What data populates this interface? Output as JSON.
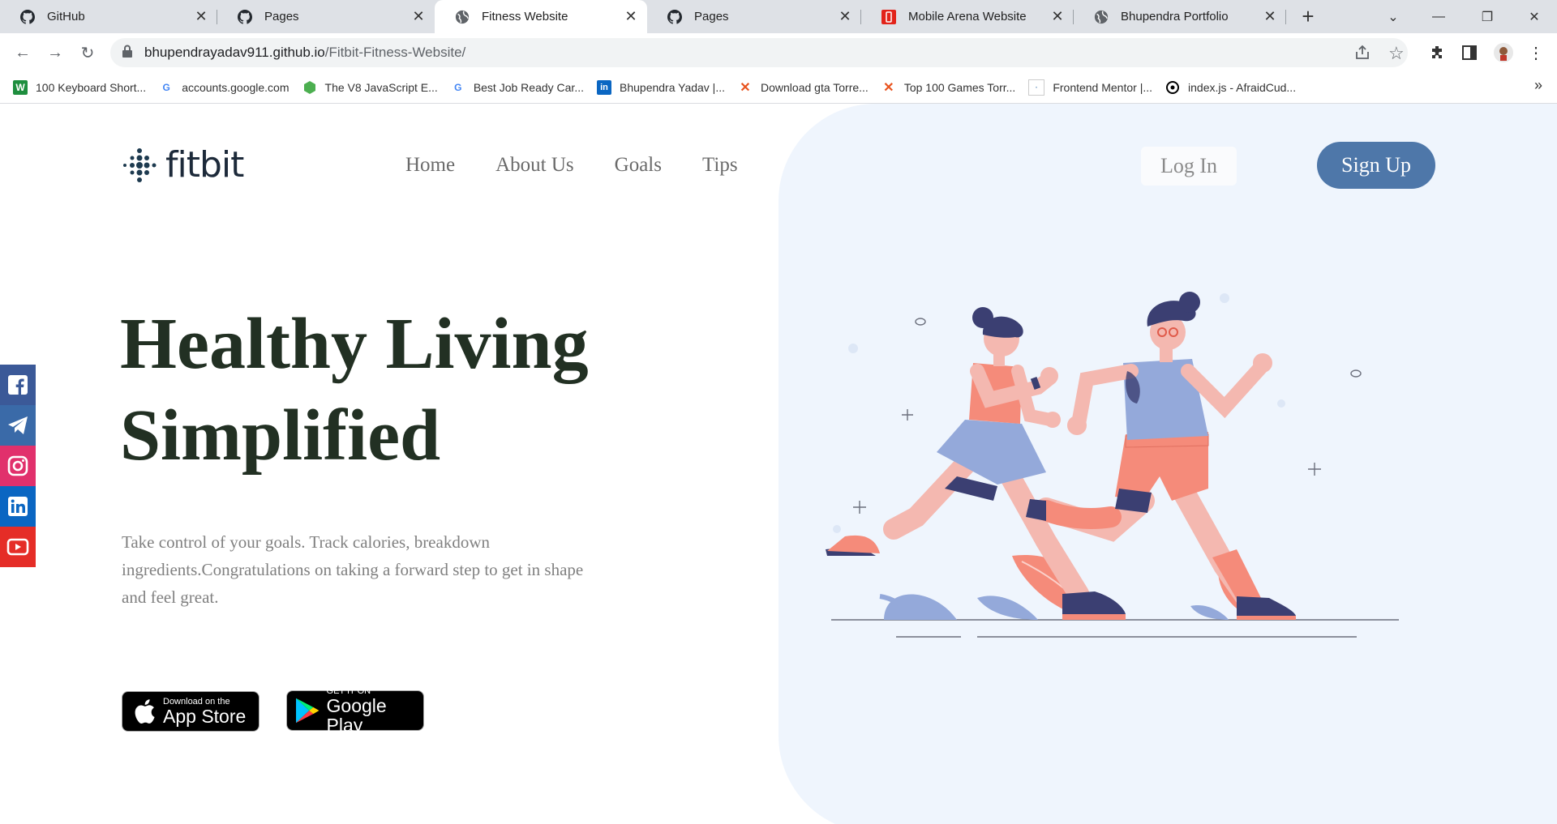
{
  "browser": {
    "tabs": [
      {
        "title": "GitHub",
        "icon": "github-icon",
        "active": false
      },
      {
        "title": "Pages",
        "icon": "github-icon",
        "active": false
      },
      {
        "title": "Fitness Website",
        "icon": "globe-icon",
        "active": true
      },
      {
        "title": "Pages",
        "icon": "github-icon",
        "active": false
      },
      {
        "title": "Mobile Arena Website",
        "icon": "mobile-arena-icon",
        "active": false
      },
      {
        "title": "Bhupendra Portfolio",
        "icon": "globe-icon",
        "active": false
      }
    ],
    "url_host": "bhupendrayadav911.github.io",
    "url_path": "/Fitbit-Fitness-Website/",
    "bookmarks": [
      {
        "label": "100 Keyboard Short...",
        "icon": "spreadsheet-icon",
        "color": "#1e8e3e"
      },
      {
        "label": "accounts.google.com",
        "icon": "google-icon",
        "color": "#4285f4"
      },
      {
        "label": "The V8 JavaScript E...",
        "icon": "v8-icon",
        "color": "#4caf50"
      },
      {
        "label": "Best Job Ready Car...",
        "icon": "google-icon",
        "color": "#4285f4"
      },
      {
        "label": "Bhupendra Yadav |...",
        "icon": "linkedin-icon",
        "color": "#0a66c2"
      },
      {
        "label": "Download gta Torre...",
        "icon": "x-icon",
        "color": "#e8531e"
      },
      {
        "label": "Top 100 Games Torr...",
        "icon": "x-icon",
        "color": "#e8531e"
      },
      {
        "label": "Frontend Mentor |...",
        "icon": "frontend-mentor-icon",
        "color": "#7aa0c8"
      },
      {
        "label": "index.js - AfraidCud...",
        "icon": "replit-icon",
        "color": "#000000"
      }
    ]
  },
  "site": {
    "logo_text": "fitbit",
    "nav": [
      "Home",
      "About Us",
      "Goals",
      "Tips"
    ],
    "login_label": "Log In",
    "signup_label": "Sign Up",
    "headline_line1": "Healthy Living",
    "headline_line2": "Simplified",
    "subtext": "Take control of your goals. Track calories, breakdown ingredients.Congratulations on taking a forward step to get in shape and feel great.",
    "appstore_small": "Download on the",
    "appstore_big": "App Store",
    "googleplay_small": "GET IT ON",
    "googleplay_big": "Google Play",
    "social": [
      {
        "name": "facebook-icon",
        "color": "#3b5998"
      },
      {
        "name": "telegram-icon",
        "color": "#3a6aa8"
      },
      {
        "name": "instagram-icon",
        "color": "#e1306c"
      },
      {
        "name": "linkedin-icon",
        "color": "#0a66c2"
      },
      {
        "name": "youtube-icon",
        "color": "#e52d27"
      }
    ],
    "colors": {
      "accent": "#4e77a9",
      "hero_bg": "#eff5fd",
      "headline": "#223023",
      "coral": "#f58b7a",
      "periwinkle": "#94a9da",
      "navy": "#3b3f72"
    }
  }
}
